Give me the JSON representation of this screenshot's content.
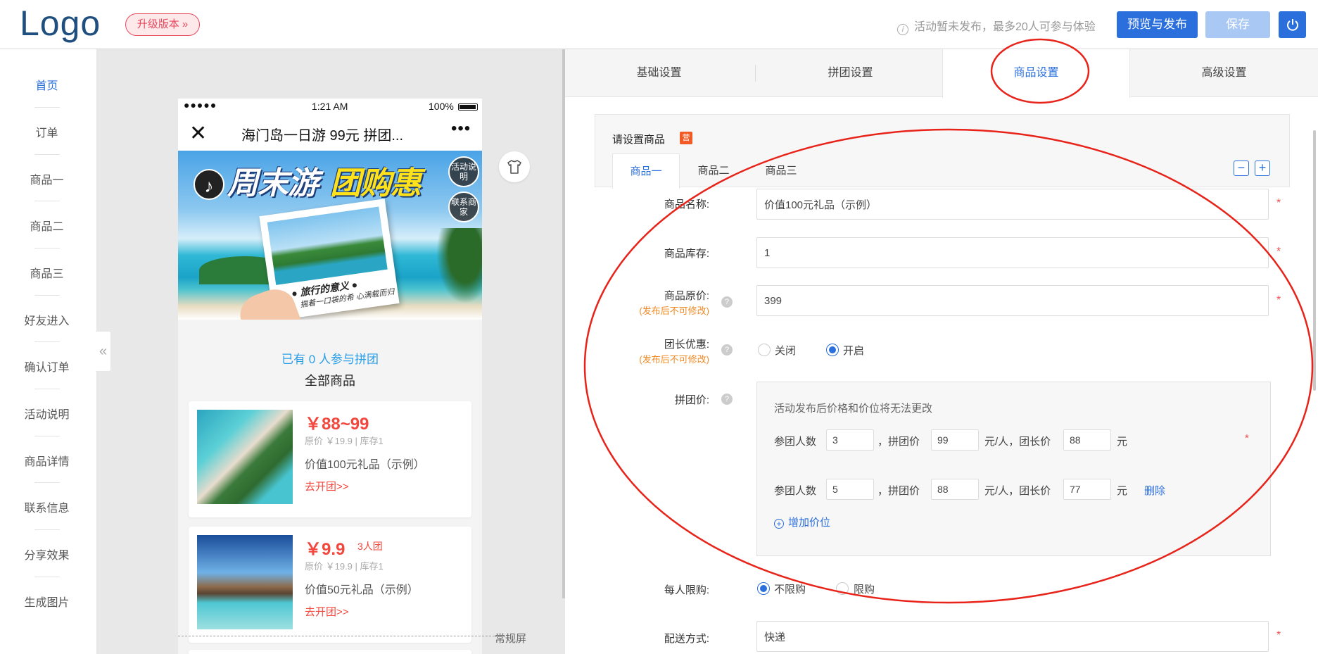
{
  "header": {
    "logo": "Logo",
    "upgrade": "升级版本 »",
    "notice_icon": "info-icon",
    "notice": "活动暂未发布，最多20人可参与体验",
    "publish": "预览与发布",
    "save": "保存",
    "power_icon": "power-icon"
  },
  "sidebar": {
    "items": [
      "首页",
      "订单",
      "商品一",
      "商品二",
      "商品三",
      "好友进入",
      "确认订单",
      "活动说明",
      "商品详情",
      "联系信息",
      "分享效果",
      "生成图片"
    ],
    "collapse": "«"
  },
  "phone": {
    "status": {
      "dots": "●●●●●",
      "time": "1:21 AM",
      "battery": "100%"
    },
    "nav_close": "✕",
    "nav_title": "海门岛一日游 99元 拼团...",
    "nav_more": "•••",
    "banner": {
      "title_a": "周末游",
      "title_b": "团购惠",
      "photo_caption1": "● 旅行的意义 ●",
      "photo_caption2": "揣着一口袋的希 心满载而归",
      "activity_btn": "活动说明",
      "contact_btn": "联系商家"
    },
    "join_count": "已有 0 人参与拼团",
    "all_goods": "全部商品",
    "goods": [
      {
        "price": "￥88~99",
        "tag": "",
        "orig": "原价 ￥19.9 | 库存1",
        "name": "价值100元礼品（示例）",
        "go": "去开团>>"
      },
      {
        "price": "￥9.9",
        "tag": "3人团",
        "orig": "原价 ￥19.9 | 库存1",
        "name": "价值50元礼品（示例）",
        "go": "去开团>>"
      }
    ],
    "normal_screen": "常规屏"
  },
  "tabs": [
    "基础设置",
    "拼团设置",
    "商品设置",
    "高级设置"
  ],
  "goods_section": {
    "label": "请设置商品",
    "required_badge": "营",
    "tabs": [
      "商品一",
      "商品二",
      "商品三"
    ],
    "minus": "−",
    "plus": "+"
  },
  "form": {
    "name_label": "商品名称:",
    "name_value": "价值100元礼品（示例）",
    "stock_label": "商品库存:",
    "stock_value": "1",
    "orig_label": "商品原价:",
    "orig_sub": "(发布后不可修改)",
    "orig_value": "399",
    "leader_label": "团长优惠:",
    "leader_sub": "(发布后不可修改)",
    "leader_off": "关闭",
    "leader_on": "开启",
    "group_price_label": "拼团价:",
    "group_note": "活动发布后价格和价位将无法更改",
    "tiers": [
      {
        "people": "3",
        "price": "99",
        "leader": "88"
      },
      {
        "people": "5",
        "price": "88",
        "leader": "77"
      }
    ],
    "tier_people_label": "参团人数",
    "tier_price_label": "，拼团价",
    "tier_leader_label": "元/人，团长价",
    "tier_unit": "元",
    "tier_delete": "删除",
    "add_tier": "增加价位",
    "limit_label": "每人限购:",
    "limit_off": "不限购",
    "limit_on": "限购",
    "delivery_label": "配送方式:",
    "delivery_value": "快递",
    "required_star": "*",
    "help": "?"
  },
  "annotation_color": "#e8231a"
}
